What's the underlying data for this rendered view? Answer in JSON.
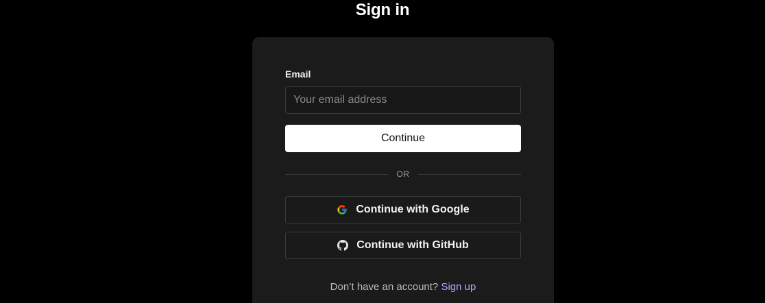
{
  "page": {
    "title": "Sign in"
  },
  "form": {
    "email_label": "Email",
    "email_value": "",
    "email_placeholder": "Your email address",
    "continue_label": "Continue",
    "divider_text": "OR"
  },
  "social": {
    "google_label": "Continue with Google",
    "google_icon": "google-icon",
    "github_label": "Continue with GitHub",
    "github_icon": "github-icon"
  },
  "footer": {
    "prompt": "Don’t have an account?",
    "signup_link": "Sign up"
  },
  "colors": {
    "background": "#000000",
    "card": "#1b1b1b",
    "primary_button": "#ffffff",
    "link": "#b9a5ff"
  }
}
